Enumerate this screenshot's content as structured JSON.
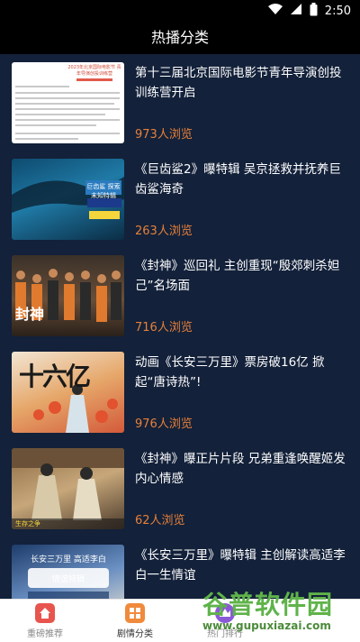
{
  "status": {
    "time": "2:50"
  },
  "header": {
    "title": "热播分类"
  },
  "list": [
    {
      "title": "第十三届北京国际电影节青年导演创投训练营开启",
      "views": "973人浏览"
    },
    {
      "title": "《巨齿鲨2》曝特辑 吴京拯救并抚养巨齿鲨海奇",
      "views": "263人浏览"
    },
    {
      "title": "《封神》巡回礼 主创重现“殷郊刺杀妲己”名场面",
      "views": "716人浏览"
    },
    {
      "title": "动画《长安三万里》票房破16亿 掀起“唐诗热”!",
      "views": "976人浏览"
    },
    {
      "title": "《封神》曝正片片段 兄弟重逢唤醒姬发内心情感",
      "views": "62人浏览"
    },
    {
      "title": "《长安三万里》曝特辑 主创解读高适李白一生情谊",
      "views": ""
    }
  ],
  "thumbs": {
    "0": "2023年北京国际电影节 青年导演创投训练营",
    "1": "巨齿鲨 探索未知特辑",
    "2": "封神",
    "3": "十六亿",
    "4": "生存之争",
    "5": "长安三万里 高适李白情谊特辑"
  },
  "tabs": [
    {
      "label": "重磅推荐",
      "color": "#e8554e"
    },
    {
      "label": "剧情分类",
      "color": "#f08a3c"
    },
    {
      "label": "热门排行",
      "color": "#8a5ad6"
    }
  ],
  "watermark": {
    "big": "谷普软件园",
    "small": "www.gupuxiazai.com"
  }
}
